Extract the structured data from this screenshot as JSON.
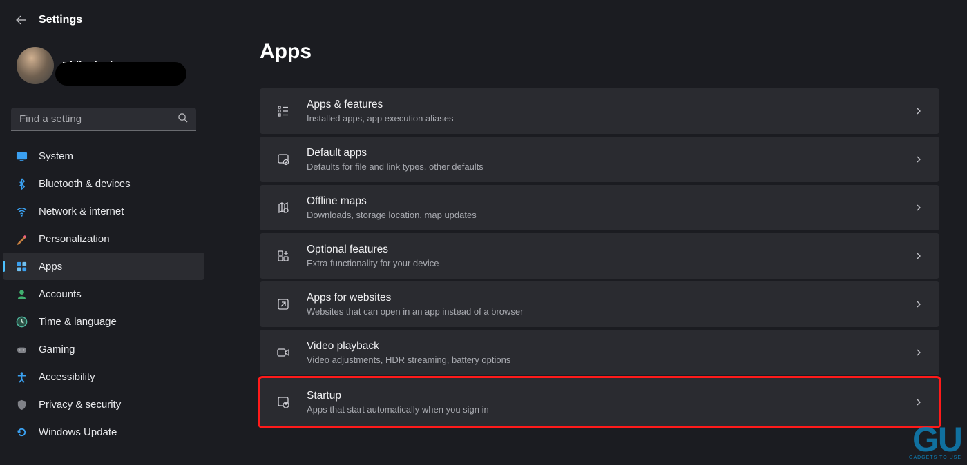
{
  "app_title": "Settings",
  "user": {
    "name": "Ritik Singh"
  },
  "search": {
    "placeholder": "Find a setting"
  },
  "nav": [
    {
      "id": "system",
      "label": "System",
      "icon": "system"
    },
    {
      "id": "bluetooth",
      "label": "Bluetooth & devices",
      "icon": "bluetooth"
    },
    {
      "id": "network",
      "label": "Network & internet",
      "icon": "network"
    },
    {
      "id": "personalization",
      "label": "Personalization",
      "icon": "personalization"
    },
    {
      "id": "apps",
      "label": "Apps",
      "icon": "apps",
      "selected": true
    },
    {
      "id": "accounts",
      "label": "Accounts",
      "icon": "accounts"
    },
    {
      "id": "time",
      "label": "Time & language",
      "icon": "time"
    },
    {
      "id": "gaming",
      "label": "Gaming",
      "icon": "gaming"
    },
    {
      "id": "accessibility",
      "label": "Accessibility",
      "icon": "accessibility"
    },
    {
      "id": "privacy",
      "label": "Privacy & security",
      "icon": "privacy"
    },
    {
      "id": "update",
      "label": "Windows Update",
      "icon": "update"
    }
  ],
  "page": {
    "title": "Apps"
  },
  "rows": [
    {
      "id": "apps-features",
      "title": "Apps & features",
      "sub": "Installed apps, app execution aliases",
      "icon": "list"
    },
    {
      "id": "default-apps",
      "title": "Default apps",
      "sub": "Defaults for file and link types, other defaults",
      "icon": "default"
    },
    {
      "id": "offline-maps",
      "title": "Offline maps",
      "sub": "Downloads, storage location, map updates",
      "icon": "map"
    },
    {
      "id": "optional-features",
      "title": "Optional features",
      "sub": "Extra functionality for your device",
      "icon": "plus-grid"
    },
    {
      "id": "apps-websites",
      "title": "Apps for websites",
      "sub": "Websites that can open in an app instead of a browser",
      "icon": "link"
    },
    {
      "id": "video-playback",
      "title": "Video playback",
      "sub": "Video adjustments, HDR streaming, battery options",
      "icon": "video"
    },
    {
      "id": "startup",
      "title": "Startup",
      "sub": "Apps that start automatically when you sign in",
      "icon": "startup",
      "highlight": true
    }
  ]
}
